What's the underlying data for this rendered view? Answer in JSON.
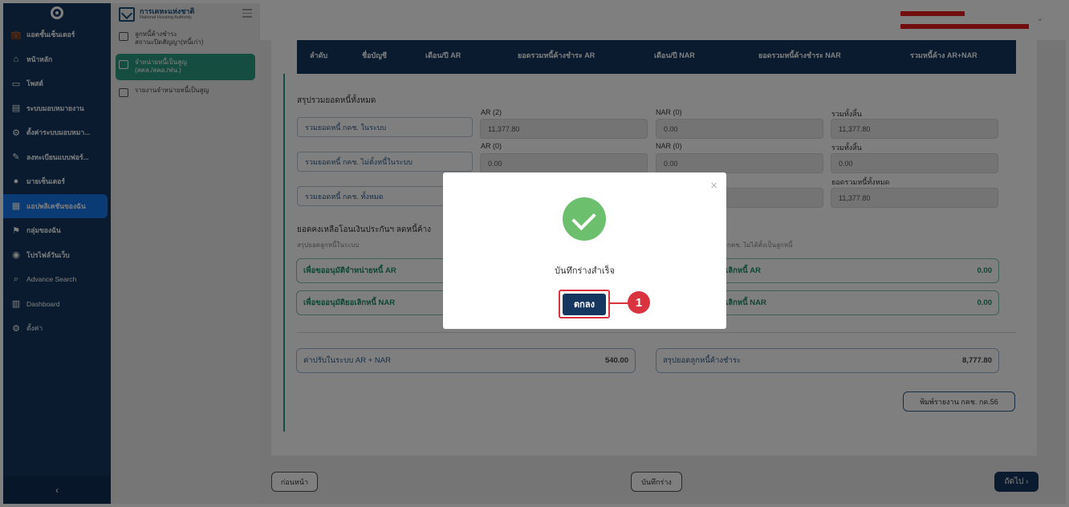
{
  "sidebar": {
    "items": [
      {
        "label": "แอดชั้นเซ็นเตอร์",
        "icon": "briefcase-icon",
        "glyph": "💼"
      },
      {
        "label": "หน้าหลัก",
        "icon": "home-icon",
        "glyph": "⌂"
      },
      {
        "label": "โพสต์",
        "icon": "post-icon",
        "glyph": "▭"
      },
      {
        "label": "ระบบมอบหมายงาน",
        "icon": "document-icon",
        "glyph": "▤"
      },
      {
        "label": "ตั้งค่าระบบมอบหมา...",
        "icon": "gear-icon",
        "glyph": "⚙"
      },
      {
        "label": "ลงทะเบียนแบบฟอร์...",
        "icon": "form-edit-icon",
        "glyph": "✎"
      },
      {
        "label": "มายเซ็นเตอร์",
        "icon": "user-icon",
        "glyph": "●"
      },
      {
        "label": "แอปพลิเคชันของฉัน",
        "icon": "apps-icon",
        "glyph": "▦"
      },
      {
        "label": "กลุ่มของฉัน",
        "icon": "group-icon",
        "glyph": "⚑"
      },
      {
        "label": "โปรไฟล์วันเว็บ",
        "icon": "profile-icon",
        "glyph": "◉"
      },
      {
        "label": "Advance Search",
        "icon": "search-icon",
        "glyph": "⌕"
      },
      {
        "label": "Dashboard",
        "icon": "chart-icon",
        "glyph": "▥"
      },
      {
        "label": "ตั้งค่า",
        "icon": "settings-icon",
        "glyph": "⚙"
      }
    ],
    "collapse_glyph": "‹"
  },
  "submenu": {
    "title": "การเคหะแห่งชาติ",
    "subtitle": "National Housing Authority",
    "items": [
      {
        "label_line1": "ลูกหนี้ค้างชำระ",
        "label_line2": "สถานะปิดสัญญา(หนี้เก่า)"
      },
      {
        "label_line1": "จำหน่ายหนี้เป็นสูญ",
        "label_line2": "(สคล./สคอ./ฟน.)"
      },
      {
        "label_line1": "รายงานจำหน่ายหนี้เป็นสูญ",
        "label_line2": ""
      }
    ]
  },
  "table_header": [
    "ลำดับ",
    "ชื่อบัญชี",
    "เดือน/ปี AR",
    "ยอดรวมหนี้ค้างชำระ AR",
    "เดือน/ปี NAR",
    "ยอดรวมหนี้ค้างชำระ NAR",
    "รวมหนี้ค้าง AR+NAR"
  ],
  "summary": {
    "title": "สรุปรวมยอดหนี้ทั้งหมด",
    "rows": [
      {
        "name": "รวมยอดหนี้ กคช. ในระบบ",
        "ar_label": "AR (2)",
        "ar_value": "11,377.80",
        "nar_label": "NAR (0)",
        "nar_value": "0.00",
        "total_label": "รวมทั้งสิ้น",
        "total_value": "11,377.80"
      },
      {
        "name": "รวมยอดหนี้ กคช. ไม่ตั้งหนี้ในระบบ",
        "ar_label": "AR (0)",
        "ar_value": "0.00",
        "nar_label": "NAR (0)",
        "nar_value": "0.00",
        "total_label": "รวมทั้งสิ้น",
        "total_value": "0.00"
      },
      {
        "name": "รวมยอดหนี้ กคช. ทั้งหมด",
        "total_label": "ยอดรวมหนี้ทั้งหมด",
        "total_value": "11,377.80"
      }
    ]
  },
  "balance": {
    "title": "ยอดคงเหลือโอนเงินประกันฯ ลดหนี้ค้าง",
    "left_caption": "สรุปยอดลูกหนี้ในระบบ",
    "right_caption": "กคช. ไม่ได้ตั้งเป็นลูกหนี้",
    "left_boxes": [
      "เพื่อขออนุมัติจำหน่ายหนี้ AR",
      "เพื่อขออนุมัติยอเลิกหนี้ NAR"
    ],
    "right_boxes": [
      {
        "label": "เลิกหนี้ AR",
        "value": "0.00"
      },
      {
        "label": "เลิกหนี้ NAR",
        "value": "0.00"
      }
    ]
  },
  "fines": {
    "left_label": "ค่าปรับในระบบ AR + NAR",
    "left_value": "540.00",
    "right_label": "สรุปยอดลูกหนี้ค้างชำระ",
    "right_value": "8,777.80"
  },
  "print_button": "พิมพ์รายงาน กคช. กค.56",
  "footer": {
    "back": "ก่อนหน้า",
    "save_draft": "บันทึกร่าง",
    "next": "ถัดไป ›"
  },
  "modal": {
    "message": "บันทึกร่างสำเร็จ",
    "ok": "ตกลง",
    "close": "×"
  },
  "callout": {
    "number": "1",
    "color": "#d9333f"
  },
  "colors": {
    "navy": "#14365f",
    "accent_blue": "#1677e8",
    "teal": "#2d9a82",
    "success": "#6cc06d"
  }
}
